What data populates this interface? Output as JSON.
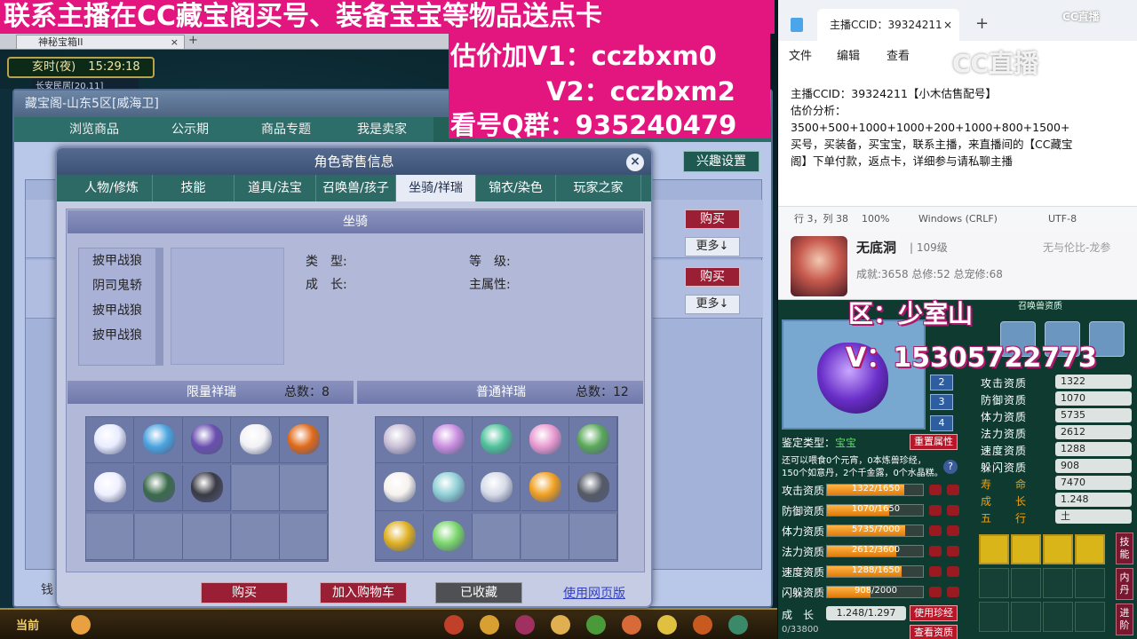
{
  "banner": {
    "headline": "联系主播在CC藏宝阁买号、装备宝宝等物品送点卡",
    "v1": "估价加V1：cczbxm0",
    "v2": "V2：cczbxm2",
    "qgroup": "看号Q群：935240479"
  },
  "browser_tab": {
    "label": "神秘宝箱II"
  },
  "game": {
    "clock_label": "亥时(夜)",
    "clock_time": "15:29:18",
    "location": "长安民居[20,11]",
    "bottom_current": "当前"
  },
  "shop": {
    "title": "藏宝阁-山东5区[威海卫]",
    "tabs": [
      "浏览商品",
      "公示期",
      "商品专题",
      "我是卖家"
    ],
    "interest_label": "兴趣设置",
    "buy_label": "购买",
    "more_label": "更多↓",
    "wallet_label": "钱"
  },
  "dialog": {
    "title": "角色寄售信息",
    "close_icon": "close-icon",
    "tabs": [
      "人物/修炼",
      "技能",
      "道具/法宝",
      "召唤兽/孩子",
      "坐骑/祥瑞",
      "锦衣/染色",
      "玩家之家"
    ],
    "selected_tab": "坐骑/祥瑞",
    "mount_section": "坐骑",
    "mounts": [
      "披甲战狼",
      "阴司鬼轿",
      "披甲战狼",
      "披甲战狼"
    ],
    "type_label": "类　型:",
    "growth_label": "成　长:",
    "level_label": "等　级:",
    "main_attr_label": "主属性:",
    "limited_title": "限量祥瑞",
    "limited_total": "总数：8",
    "normal_title": "普通祥瑞",
    "normal_total": "总数：12",
    "limited_colors": [
      "#e8ecff",
      "#4aa3e0",
      "#6a4fb0",
      "#f2f2f6",
      "#e06a1a",
      "#eef0ff",
      "#3a6b4a",
      "#3a3a44"
    ],
    "normal_colors": [
      "#c9bfd6",
      "#c98ee0",
      "#4fc29a",
      "#e89ad0",
      "#5aa85a",
      "#f6f2ee",
      "#8fd0d6",
      "#d6dbe8",
      "#f0a020",
      "#555a66",
      "#e0b020",
      "#7ad66a"
    ],
    "buy_btn": "购买",
    "cart_btn": "加入购物车",
    "collected_btn": "已收藏",
    "web_link": "使用网页版"
  },
  "notepad": {
    "tab_title": "主播CCID：39324211",
    "menu": [
      "文件",
      "编辑",
      "查看"
    ],
    "lines": [
      "主播CCID：39324211【小木估售配号】",
      "估价分析：",
      "3500+500+1000+1000+200+1000+800+1500+",
      "买号，买装备，买宝宝，联系主播，来直播间的【CC藏宝",
      "阁】下单付款，返点卡，详细参与请私聊主播"
    ],
    "status_pos": "行 3，列 38",
    "status_zoom": "100%",
    "status_eol": "Windows (CRLF)",
    "status_enc": "UTF-8",
    "logo_small": "CC直播",
    "logo_big": "CC直播"
  },
  "profile": {
    "name": "无底洞",
    "level": "| 109级",
    "server": "无与伦比-龙参",
    "stats": "成就:3658 总修:52 总宠修:68"
  },
  "pet_panel": {
    "header": "召唤兽资质",
    "zone_overlay": "区：少室山",
    "v_overlay": "V：15305722773",
    "num_buttons": [
      "2",
      "3",
      "4"
    ],
    "appraise_label": "鉴定类型：",
    "appraise_value": "宝宝",
    "reset_btn": "重置属性",
    "note1": "还可以喂食0个元宵，0本炼兽珍经，",
    "note2": "150个如意丹，2个千金露，0个水晶糕。",
    "bars": [
      {
        "label": "攻击资质",
        "text": "1322/1650",
        "ratio": 0.801
      },
      {
        "label": "防御资质",
        "text": "1070/1650",
        "ratio": 0.648
      },
      {
        "label": "体力资质",
        "text": "5735/7000",
        "ratio": 0.819
      },
      {
        "label": "法力资质",
        "text": "2612/3600",
        "ratio": 0.726
      },
      {
        "label": "速度资质",
        "text": "1288/1650",
        "ratio": 0.781
      },
      {
        "label": "闪躲资质",
        "text": "908/2000",
        "ratio": 0.454
      }
    ],
    "growth_label": "成　长",
    "growth_value": "1.248/1.297",
    "use_btn": "使用珍经",
    "attrs": [
      {
        "label": "攻击资质",
        "value": "1322"
      },
      {
        "label": "防御资质",
        "value": "1070"
      },
      {
        "label": "体力资质",
        "value": "5735"
      },
      {
        "label": "法力资质",
        "value": "2612"
      },
      {
        "label": "速度资质",
        "value": "1288"
      },
      {
        "label": "躲闪资质",
        "value": "908"
      },
      {
        "label": "寿　　命",
        "value": "7470"
      },
      {
        "label": "成　　长",
        "value": "1.248"
      },
      {
        "label": "五　　行",
        "value": "土"
      }
    ],
    "side_buttons": [
      "技能",
      "内丹",
      "进阶"
    ],
    "bottom_text": "0/33800",
    "bottom_right": "查看资质"
  }
}
